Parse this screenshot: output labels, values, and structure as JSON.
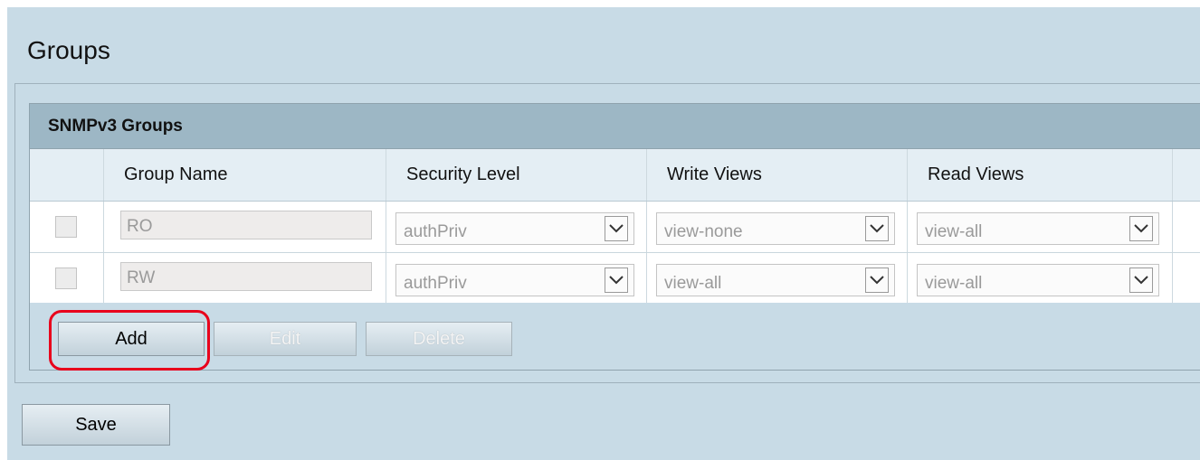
{
  "page": {
    "title": "Groups"
  },
  "table": {
    "caption": "SNMPv3 Groups",
    "headers": [
      "Group Name",
      "Security Level",
      "Write Views",
      "Read Views"
    ],
    "rows": [
      {
        "group_name": "RO",
        "security_level": "authPriv",
        "write_views": "view-none",
        "read_views": "view-all"
      },
      {
        "group_name": "RW",
        "security_level": "authPriv",
        "write_views": "view-all",
        "read_views": "view-all"
      }
    ]
  },
  "buttons": {
    "add": "Add",
    "edit": "Edit",
    "delete": "Delete",
    "save": "Save"
  },
  "colors": {
    "background": "#c8dbe6",
    "caption_bar": "#9db7c5",
    "highlight": "#e8001c"
  },
  "icons": {
    "dropdown": "chevron-down-icon"
  }
}
